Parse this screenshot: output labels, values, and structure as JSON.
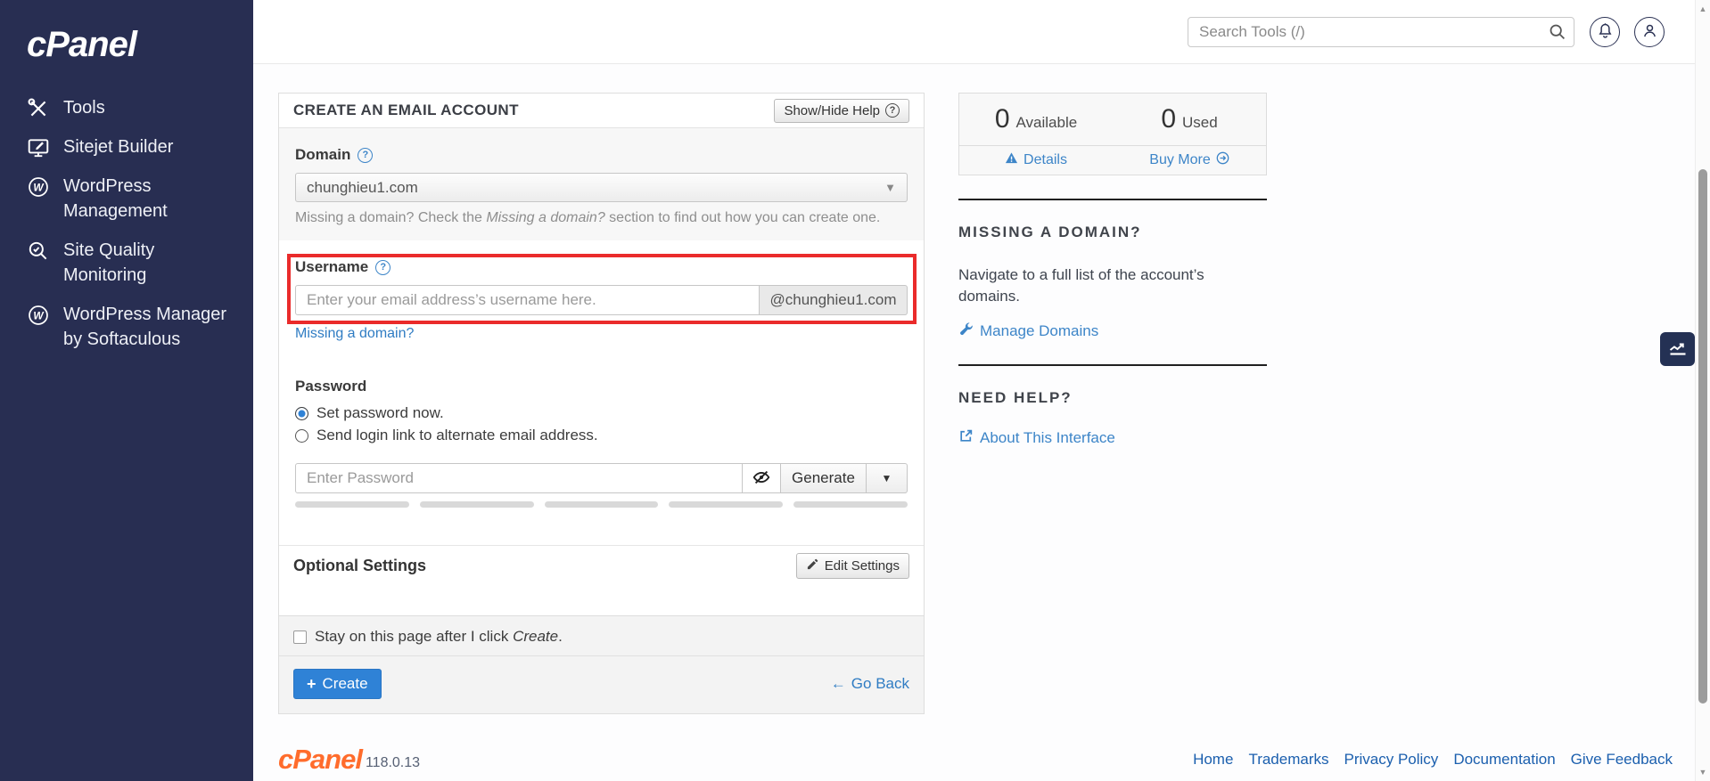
{
  "sidebar": {
    "logo": "cPanel",
    "items": [
      {
        "label": "Tools",
        "icon": "tools-icon"
      },
      {
        "label": "Sitejet Builder",
        "icon": "sitejet-icon"
      },
      {
        "label": "WordPress Management",
        "icon": "wordpress-icon"
      },
      {
        "label": "Site Quality Monitoring",
        "icon": "site-quality-icon"
      },
      {
        "label": "WordPress Manager by Softaculous",
        "icon": "wordpress-icon"
      }
    ]
  },
  "header": {
    "search_placeholder": "Search Tools (/)"
  },
  "form": {
    "title": "CREATE AN EMAIL ACCOUNT",
    "help_button": "Show/Hide Help",
    "domain": {
      "label": "Domain",
      "value": "chunghieu1.com",
      "hint_prefix": "Missing a domain? Check the ",
      "hint_italic": "Missing a domain?",
      "hint_suffix": " section to find out how you can create one."
    },
    "username": {
      "label": "Username",
      "placeholder": "Enter your email address’s username here.",
      "domain_addon": "@chunghieu1.com",
      "missing_domain_link": "Missing a domain?"
    },
    "password": {
      "label": "Password",
      "set_now": "Set password now.",
      "send_link": "Send login link to alternate email address.",
      "placeholder": "Enter Password",
      "generate_label": "Generate"
    },
    "optional": {
      "label": "Optional Settings",
      "edit_label": "Edit Settings"
    },
    "stay_prefix": "Stay on this page after I click ",
    "stay_italic": "Create",
    "stay_suffix": ".",
    "create_label": "Create",
    "go_back_label": "Go Back"
  },
  "quota": {
    "available_value": "0",
    "available_label": "Available",
    "used_value": "0",
    "used_label": "Used",
    "details_label": "Details",
    "buy_more_label": "Buy More"
  },
  "missing_domain_panel": {
    "title": "MISSING A DOMAIN?",
    "body": "Navigate to a full list of the account’s domains.",
    "link": "Manage Domains"
  },
  "need_help_panel": {
    "title": "NEED HELP?",
    "link": "About This Interface"
  },
  "page_footer": {
    "brand": "cPanel",
    "version": "118.0.13",
    "links": [
      "Home",
      "Trademarks",
      "Privacy Policy",
      "Documentation",
      "Give Feedback"
    ]
  },
  "icons": {
    "tools-icon": "crossed wrench and screwdriver",
    "sitejet-icon": "monitor with pen",
    "wordpress-icon": "W in circle",
    "site-quality-icon": "magnifier with check",
    "search-icon": "magnifier",
    "bell-icon": "notification bell",
    "user-icon": "person silhouette",
    "help-icon": "question mark circle",
    "warning-icon": "alert triangle",
    "arrow-circle-icon": "arrow right in circle",
    "wrench-icon": "wrench",
    "external-link-icon": "box with arrow",
    "pencil-icon": "pencil",
    "eye-slash-icon": "hidden password eye",
    "chart-line-icon": "trending line chart"
  },
  "colors": {
    "sidebar_navy": "#282e52",
    "link_blue": "#3d85c8",
    "button_blue": "#2f82d6",
    "brand_orange": "#ff6c2c",
    "highlight_red": "#ea2b2b"
  }
}
